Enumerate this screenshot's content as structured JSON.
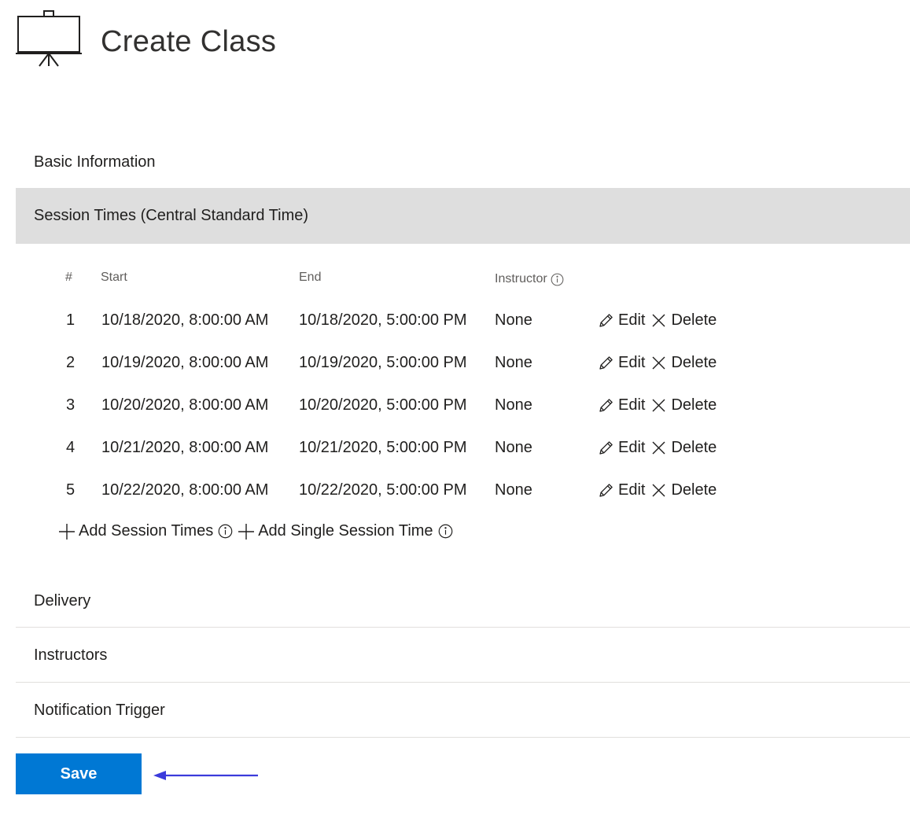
{
  "page": {
    "title": "Create Class"
  },
  "sections": {
    "basic": "Basic Information",
    "session": "Session Times (Central Standard Time)",
    "delivery": "Delivery",
    "instructors": "Instructors",
    "notification": "Notification Trigger"
  },
  "table": {
    "headers": {
      "num": "#",
      "start": "Start",
      "end": "End",
      "instructor": "Instructor"
    },
    "rows": [
      {
        "num": "1",
        "start": "10/18/2020, 8:00:00 AM",
        "end": "10/18/2020, 5:00:00 PM",
        "instructor": "None"
      },
      {
        "num": "2",
        "start": "10/19/2020, 8:00:00 AM",
        "end": "10/19/2020, 5:00:00 PM",
        "instructor": "None"
      },
      {
        "num": "3",
        "start": "10/20/2020, 8:00:00 AM",
        "end": "10/20/2020, 5:00:00 PM",
        "instructor": "None"
      },
      {
        "num": "4",
        "start": "10/21/2020, 8:00:00 AM",
        "end": "10/21/2020, 5:00:00 PM",
        "instructor": "None"
      },
      {
        "num": "5",
        "start": "10/22/2020, 8:00:00 AM",
        "end": "10/22/2020, 5:00:00 PM",
        "instructor": "None"
      }
    ],
    "edit_label": "Edit",
    "delete_label": "Delete"
  },
  "actions": {
    "add_session_times": "Add Session Times",
    "add_single_session_time": "Add Single Session Time"
  },
  "save_label": "Save",
  "colors": {
    "primary": "#0078d4",
    "selected_section_bg": "#dedede",
    "annotation_arrow": "#3b3bdb"
  },
  "icons": [
    "presentation-board-icon",
    "info-icon",
    "pencil-icon",
    "close-icon",
    "plus-icon",
    "arrow-left-icon"
  ]
}
